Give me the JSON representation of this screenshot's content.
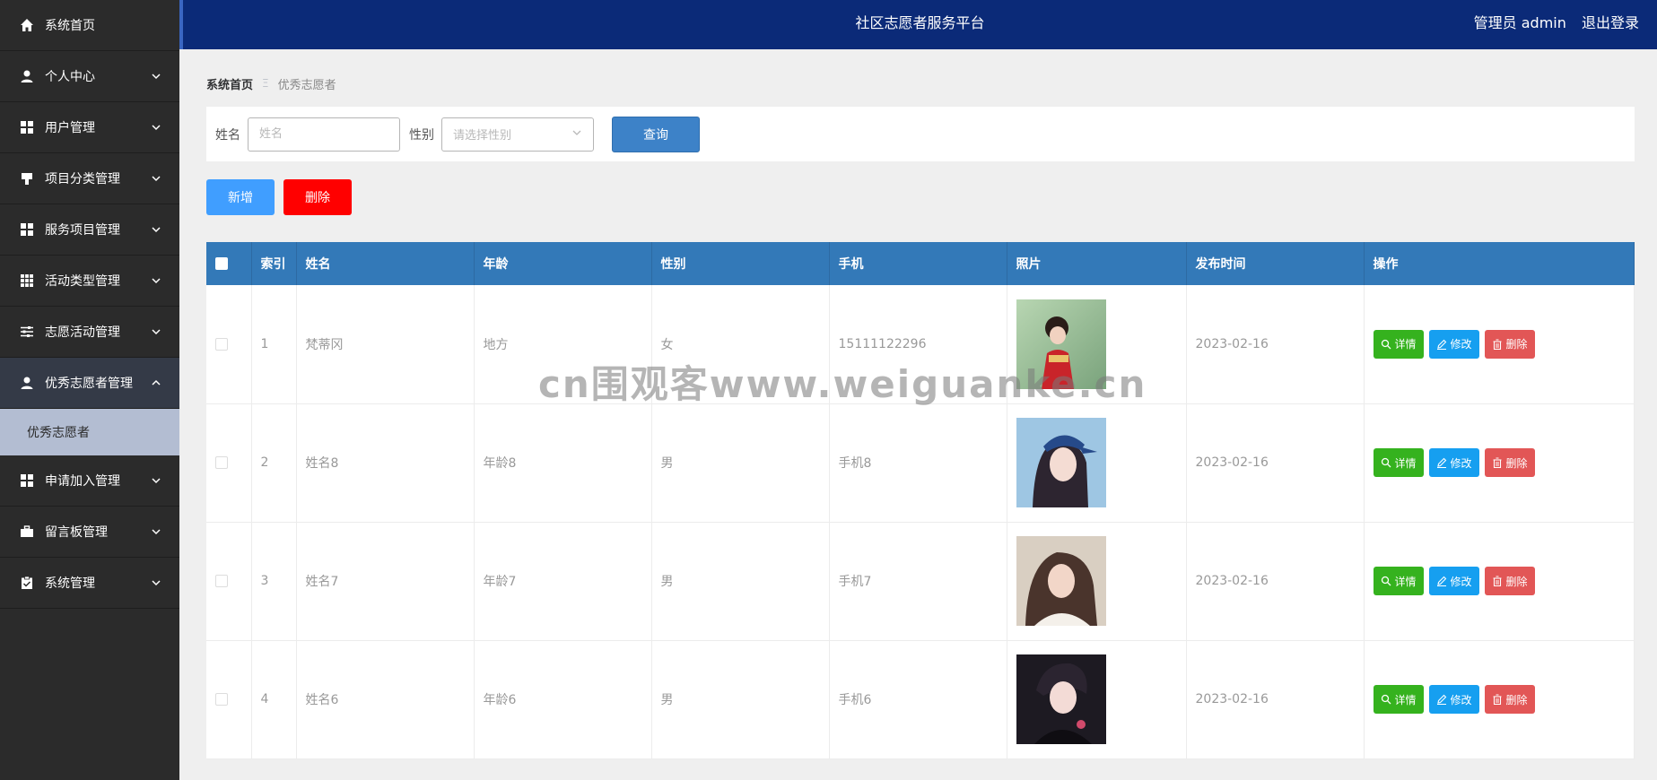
{
  "header": {
    "title": "社区志愿者服务平台",
    "user": "管理员 admin",
    "logout": "退出登录"
  },
  "sidebar": {
    "items": [
      {
        "label": "系统首页",
        "icon": "home-icon"
      },
      {
        "label": "个人中心",
        "icon": "user-icon"
      },
      {
        "label": "用户管理",
        "icon": "grid-icon"
      },
      {
        "label": "项目分类管理",
        "icon": "tag-icon"
      },
      {
        "label": "服务项目管理",
        "icon": "grid-icon"
      },
      {
        "label": "活动类型管理",
        "icon": "table-icon"
      },
      {
        "label": "志愿活动管理",
        "icon": "sliders-icon"
      },
      {
        "label": "优秀志愿者管理",
        "icon": "user-icon"
      },
      {
        "label": "申请加入管理",
        "icon": "grid-icon"
      },
      {
        "label": "留言板管理",
        "icon": "briefcase-icon"
      },
      {
        "label": "系统管理",
        "icon": "clipboard-icon"
      }
    ],
    "sub_item": "优秀志愿者"
  },
  "breadcrumb": {
    "home": "系统首页",
    "sep": "Ξ",
    "current": "优秀志愿者"
  },
  "search": {
    "name_label": "姓名",
    "name_placeholder": "姓名",
    "gender_label": "性别",
    "gender_placeholder": "请选择性别",
    "query_label": "查询"
  },
  "actions": {
    "add": "新增",
    "delete": "删除"
  },
  "table": {
    "headers": [
      "索引",
      "姓名",
      "年龄",
      "性别",
      "手机",
      "照片",
      "发布时间",
      "操作"
    ],
    "rows": [
      {
        "index": "1",
        "name": "梵蒂冈",
        "age": "地方",
        "gender": "女",
        "phone": "15111122296",
        "date": "2023-02-16"
      },
      {
        "index": "2",
        "name": "姓名8",
        "age": "年龄8",
        "gender": "男",
        "phone": "手机8",
        "date": "2023-02-16"
      },
      {
        "index": "3",
        "name": "姓名7",
        "age": "年龄7",
        "gender": "男",
        "phone": "手机7",
        "date": "2023-02-16"
      },
      {
        "index": "4",
        "name": "姓名6",
        "age": "年龄6",
        "gender": "男",
        "phone": "手机6",
        "date": "2023-02-16"
      }
    ],
    "ops": {
      "detail": "详情",
      "edit": "修改",
      "delete": "删除"
    }
  },
  "watermark": "cn围观客www.weiguanke.cn",
  "colors": {
    "header": "#0b2a78",
    "sidebar": "#2b2b2b",
    "table_head": "#3379b8",
    "add": "#409eff",
    "delete": "#ff0000"
  }
}
